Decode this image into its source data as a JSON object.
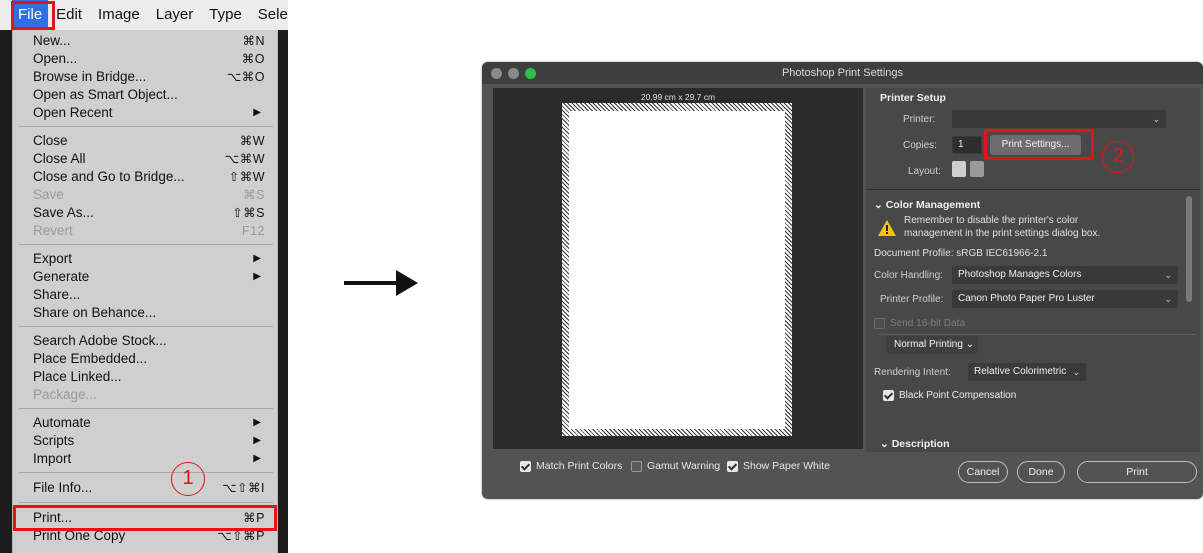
{
  "menubar": {
    "items": [
      "File",
      "Edit",
      "Image",
      "Layer",
      "Type",
      "Selec"
    ]
  },
  "file_menu": {
    "items": [
      {
        "label": "New...",
        "shortcut": "⌘N"
      },
      {
        "label": "Open...",
        "shortcut": "⌘O"
      },
      {
        "label": "Browse in Bridge...",
        "shortcut": "⌥⌘O"
      },
      {
        "label": "Open as Smart Object...",
        "shortcut": ""
      },
      {
        "label": "Open Recent",
        "submenu": true
      },
      {
        "label": "Close",
        "shortcut": "⌘W"
      },
      {
        "label": "Close All",
        "shortcut": "⌥⌘W"
      },
      {
        "label": "Close and Go to Bridge...",
        "shortcut": "⇧⌘W"
      },
      {
        "label": "Save",
        "shortcut": "⌘S",
        "disabled": true
      },
      {
        "label": "Save As...",
        "shortcut": "⇧⌘S"
      },
      {
        "label": "Revert",
        "shortcut": "F12",
        "disabled": true
      },
      {
        "label": "Export",
        "submenu": true
      },
      {
        "label": "Generate",
        "submenu": true
      },
      {
        "label": "Share..."
      },
      {
        "label": "Share on Behance..."
      },
      {
        "label": "Search Adobe Stock..."
      },
      {
        "label": "Place Embedded..."
      },
      {
        "label": "Place Linked..."
      },
      {
        "label": "Package...",
        "disabled": true
      },
      {
        "label": "Automate",
        "submenu": true
      },
      {
        "label": "Scripts",
        "submenu": true
      },
      {
        "label": "Import",
        "submenu": true
      },
      {
        "label": "File Info...",
        "shortcut": "⌥⇧⌘I"
      },
      {
        "label": "Print...",
        "shortcut": "⌘P"
      },
      {
        "label": "Print One Copy",
        "shortcut": "⌥⇧⌘P"
      }
    ],
    "step_number": "1"
  },
  "dialog": {
    "title": "Photoshop Print Settings",
    "paper_size": "20.99 cm x 29.7 cm",
    "checkboxes": {
      "match_print_colors": "Match Print Colors",
      "gamut_warning": "Gamut Warning",
      "show_paper_white": "Show Paper White"
    },
    "printer_setup": {
      "title": "Printer Setup",
      "printer_label": "Printer:",
      "printer_value": "",
      "copies_label": "Copies:",
      "copies_value": "1",
      "print_settings_button": "Print Settings...",
      "layout_label": "Layout:",
      "step_number": "2"
    },
    "color_management": {
      "title": "Color Management",
      "warning": "Remember to disable the printer's color management in the print settings dialog box.",
      "warning_line1": "Remember to disable the printer's color",
      "warning_line2": "management in the print settings dialog box.",
      "document_profile": "Document Profile: sRGB IEC61966-2.1",
      "color_handling_label": "Color Handling:",
      "color_handling_value": "Photoshop Manages Colors",
      "printer_profile_label": "Printer Profile:",
      "printer_profile_value": "Canon Photo Paper Pro Luster",
      "send_16bit": "Send 16-bit Data",
      "normal_printing": "Normal Printing",
      "rendering_intent_label": "Rendering Intent:",
      "rendering_intent_value": "Relative Colorimetric",
      "black_point": "Black Point Compensation"
    },
    "description": {
      "title": "Description"
    },
    "buttons": {
      "cancel": "Cancel",
      "done": "Done",
      "print": "Print"
    }
  },
  "colors": {
    "accent_red": "#e3121b",
    "menu_highlight": "#2f6fe3"
  }
}
